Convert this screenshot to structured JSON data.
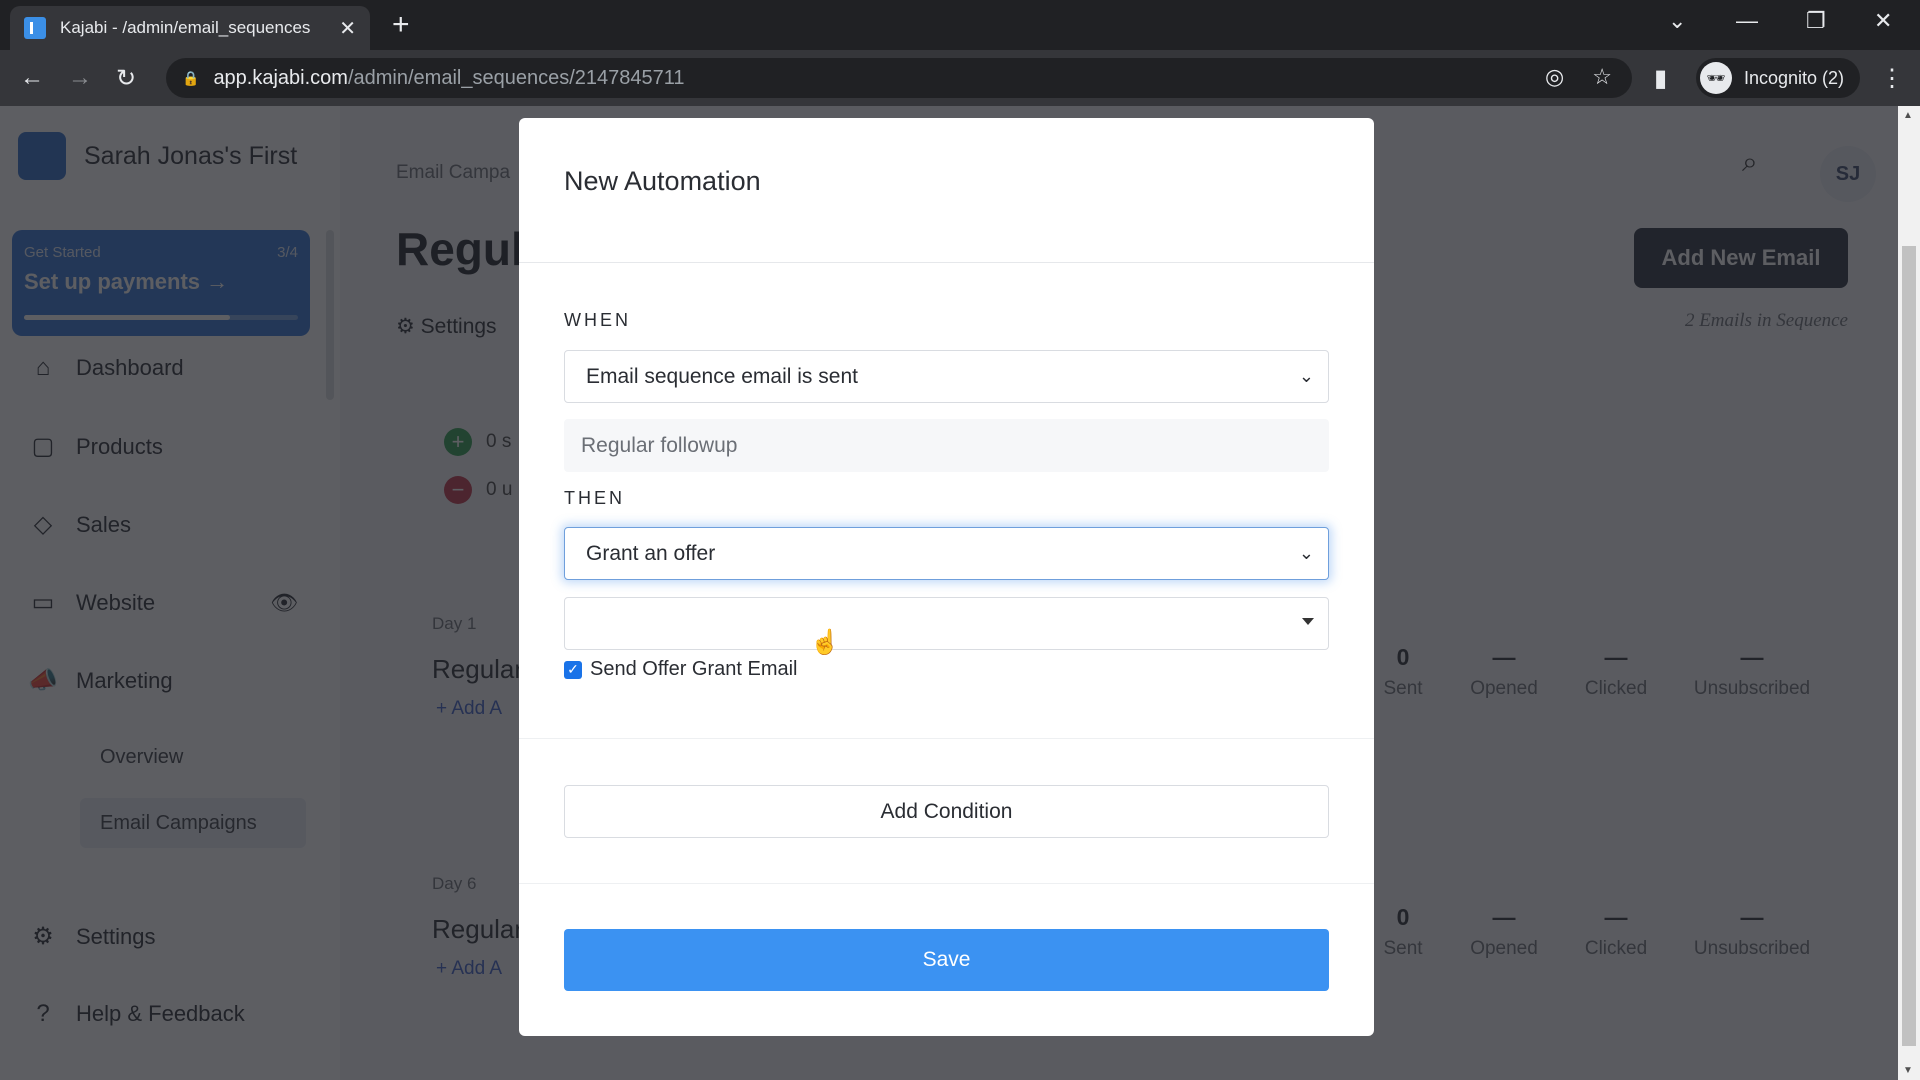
{
  "browser": {
    "tab_title": "Kajabi - /admin/email_sequences",
    "url_host": "app.kajabi.com",
    "url_path": "/admin/email_sequences/2147845711",
    "profile_label": "Incognito (2)"
  },
  "sidebar": {
    "site_name": "Sarah Jonas's First",
    "get_started": {
      "label": "Get Started",
      "progress_text": "3/4",
      "progress_fraction": 0.75,
      "action": "Set up payments"
    },
    "items": [
      {
        "label": "Dashboard",
        "icon": "home-icon"
      },
      {
        "label": "Products",
        "icon": "box-icon"
      },
      {
        "label": "Sales",
        "icon": "tag-icon"
      },
      {
        "label": "Website",
        "icon": "monitor-icon"
      },
      {
        "label": "Marketing",
        "icon": "megaphone-icon"
      }
    ],
    "subitems": [
      {
        "label": "Overview"
      },
      {
        "label": "Email Campaigns",
        "active": true
      }
    ],
    "bottom": [
      {
        "label": "Settings",
        "icon": "gear-icon"
      },
      {
        "label": "Help & Feedback",
        "icon": "help-icon"
      }
    ]
  },
  "main": {
    "breadcrumb": "Email Campa",
    "title": "Regul",
    "settings_label": "Settings",
    "add_new_email": "Add New Email",
    "email_count": "2 Emails in Sequence",
    "avatar_initials": "SJ",
    "subscribers": [
      {
        "text": "0 s",
        "color": "#2e9e4f"
      },
      {
        "text": "0 u",
        "color": "#c2334a"
      }
    ],
    "emails": [
      {
        "day": "Day 1",
        "title": "Regular",
        "add": "+ Add A",
        "stats": [
          {
            "v": "0",
            "l": "Sent"
          },
          {
            "v": "—",
            "l": "Opened"
          },
          {
            "v": "—",
            "l": "Clicked"
          },
          {
            "v": "—",
            "l": "Unsubscribed"
          }
        ]
      },
      {
        "day": "Day 6",
        "title": "Regular",
        "add": "+ Add A",
        "stats": [
          {
            "v": "0",
            "l": "Sent"
          },
          {
            "v": "—",
            "l": "Opened"
          },
          {
            "v": "—",
            "l": "Clicked"
          },
          {
            "v": "—",
            "l": "Unsubscribed"
          }
        ]
      }
    ]
  },
  "modal": {
    "title": "New Automation",
    "when_label": "WHEN",
    "when_value": "Email sequence email is sent",
    "when_target": "Regular followup",
    "then_label": "THEN",
    "then_value": "Grant an offer",
    "offer_value": "",
    "send_email_label": "Send Offer Grant Email",
    "send_email_checked": true,
    "add_condition": "Add Condition",
    "save": "Save"
  }
}
